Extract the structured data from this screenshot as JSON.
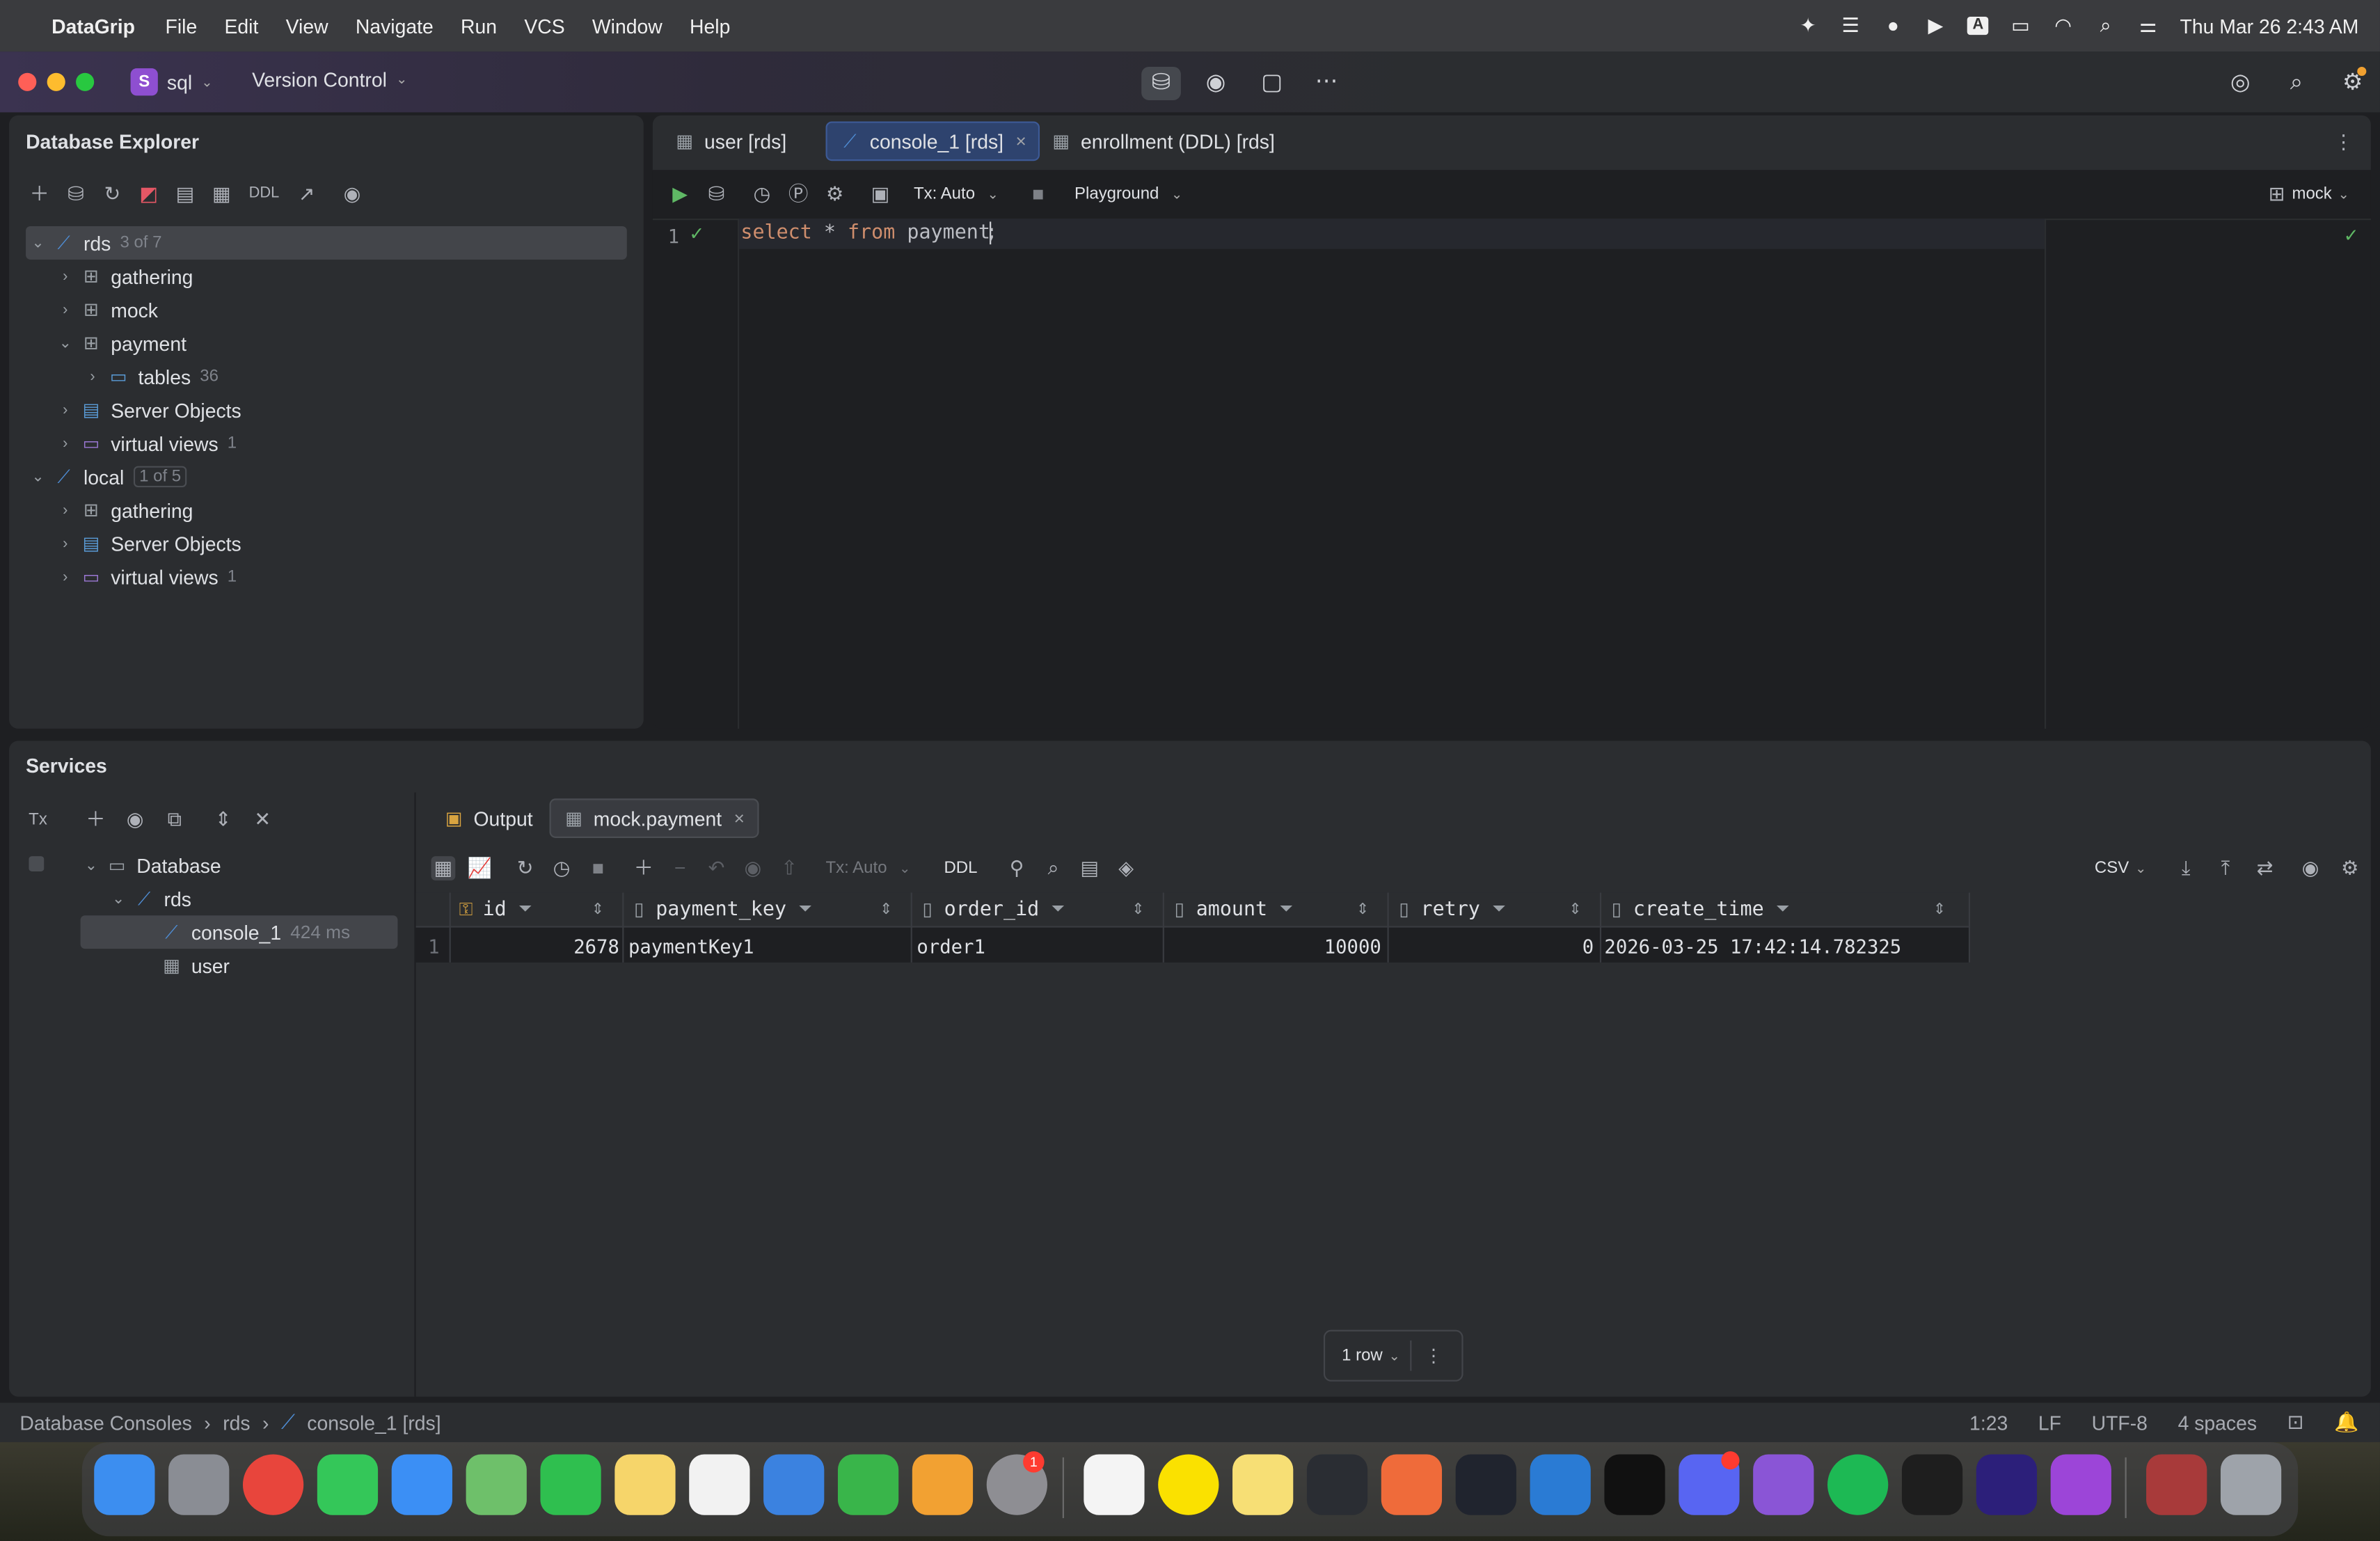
{
  "menubar": {
    "app": "DataGrip",
    "items": [
      "File",
      "Edit",
      "View",
      "Navigate",
      "Run",
      "VCS",
      "Window",
      "Help"
    ],
    "clock": "Thu Mar 26  2:43 AM"
  },
  "titlebar": {
    "project_badge": "S",
    "project": "sql",
    "vcs": "Version Control"
  },
  "explorer": {
    "title": "Database Explorer",
    "ddl": "DDL",
    "rds": {
      "label": "rds",
      "count": "3 of 7"
    },
    "rds_children": [
      {
        "label": "gathering"
      },
      {
        "label": "mock"
      },
      {
        "label": "payment"
      }
    ],
    "tables": {
      "label": "tables",
      "count": "36"
    },
    "rds_server_objects": "Server Objects",
    "rds_virtual_views": {
      "label": "virtual views",
      "count": "1"
    },
    "local": {
      "label": "local",
      "count": "1 of 5"
    },
    "local_gathering": "gathering",
    "local_server_objects": "Server Objects",
    "local_virtual_views": {
      "label": "virtual views",
      "count": "1"
    }
  },
  "editor": {
    "tabs": [
      {
        "label": "user [rds]"
      },
      {
        "label": "console_1 [rds]"
      },
      {
        "label": "enrollment (DDL) [rds]"
      }
    ],
    "tx": "Tx: Auto",
    "playground": "Playground",
    "schema": "mock",
    "line_number": "1",
    "code": {
      "kw1": "select",
      "star": "*",
      "kw2": "from",
      "table": "payment",
      "semi": ";"
    }
  },
  "services": {
    "title": "Services",
    "tx_label": "Tx",
    "tree": {
      "database": "Database",
      "rds": "rds",
      "console": "console_1",
      "console_time": "424 ms",
      "user": "user"
    },
    "tabs": {
      "output": "Output",
      "result": "mock.payment"
    },
    "toolbar": {
      "tx": "Tx: Auto",
      "ddl": "DDL",
      "csv": "CSV"
    },
    "grid": {
      "columns": [
        "id",
        "payment_key",
        "order_id",
        "amount",
        "retry",
        "create_time"
      ],
      "rows": [
        {
          "n": "1",
          "id": "2678",
          "payment_key": "paymentKey1",
          "order_id": "order1",
          "amount": "10000",
          "retry": "0",
          "create_time": "2026-03-25 17:42:14.782325"
        }
      ],
      "row_count": "1 row"
    }
  },
  "statusbar": {
    "breadcrumb": [
      "Database Consoles",
      "rds",
      "console_1 [rds]"
    ],
    "position": "1:23",
    "line_sep": "LF",
    "encoding": "UTF-8",
    "indent": "4 spaces"
  },
  "dock": {
    "badges": {
      "settings": "1"
    }
  },
  "colors": {
    "accent": "#3d5a96",
    "keyword": "#cf8e6d",
    "run_green": "#5fb865",
    "folder": "#9b78d4"
  }
}
